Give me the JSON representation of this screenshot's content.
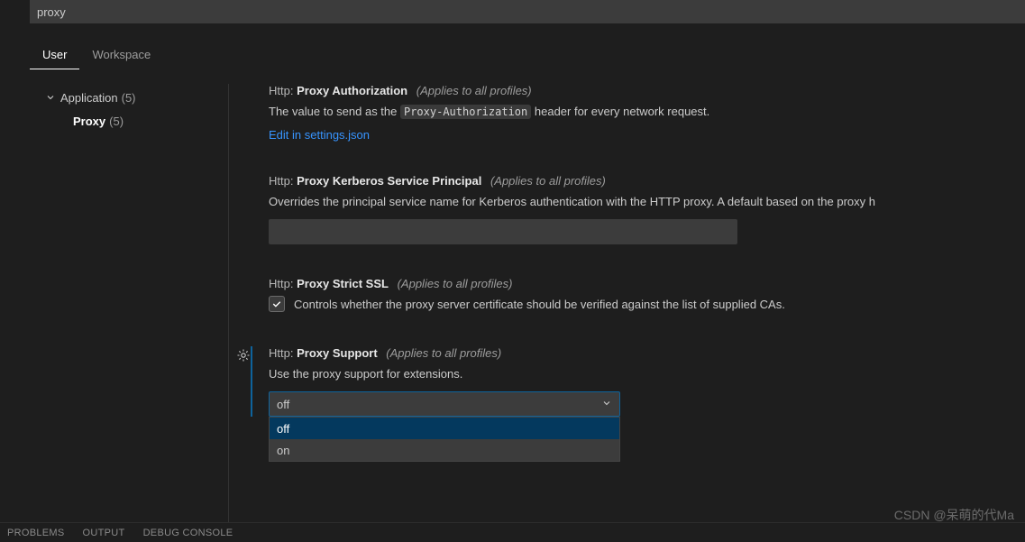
{
  "search": {
    "value": "proxy"
  },
  "tabs": {
    "user": "User",
    "workspace": "Workspace"
  },
  "tree": {
    "groupLabel": "Application",
    "groupCount": "(5)",
    "childLabel": "Proxy",
    "childCount": "(5)"
  },
  "settings": {
    "proxyAuth": {
      "cat": "Http:",
      "name": "Proxy Authorization",
      "profiles": "(Applies to all profiles)",
      "descPre": "The value to send as the ",
      "code": "Proxy-Authorization",
      "descPost": " header for every network request.",
      "editLink": "Edit in settings.json"
    },
    "kerberos": {
      "cat": "Http:",
      "name": "Proxy Kerberos Service Principal",
      "profiles": "(Applies to all profiles)",
      "desc": "Overrides the principal service name for Kerberos authentication with the HTTP proxy. A default based on the proxy h"
    },
    "strictSsl": {
      "cat": "Http:",
      "name": "Proxy Strict SSL",
      "profiles": "(Applies to all profiles)",
      "checkDesc": "Controls whether the proxy server certificate should be verified against the list of supplied CAs."
    },
    "proxySupport": {
      "cat": "Http:",
      "name": "Proxy Support",
      "profiles": "(Applies to all profiles)",
      "desc": "Use the proxy support for extensions.",
      "selected": "off",
      "options": [
        "off",
        "on"
      ]
    }
  },
  "panel": {
    "problems": "PROBLEMS",
    "output": "OUTPUT",
    "debug": "DEBUG CONSOLE"
  },
  "watermark": "CSDN @呆萌的代Ma"
}
